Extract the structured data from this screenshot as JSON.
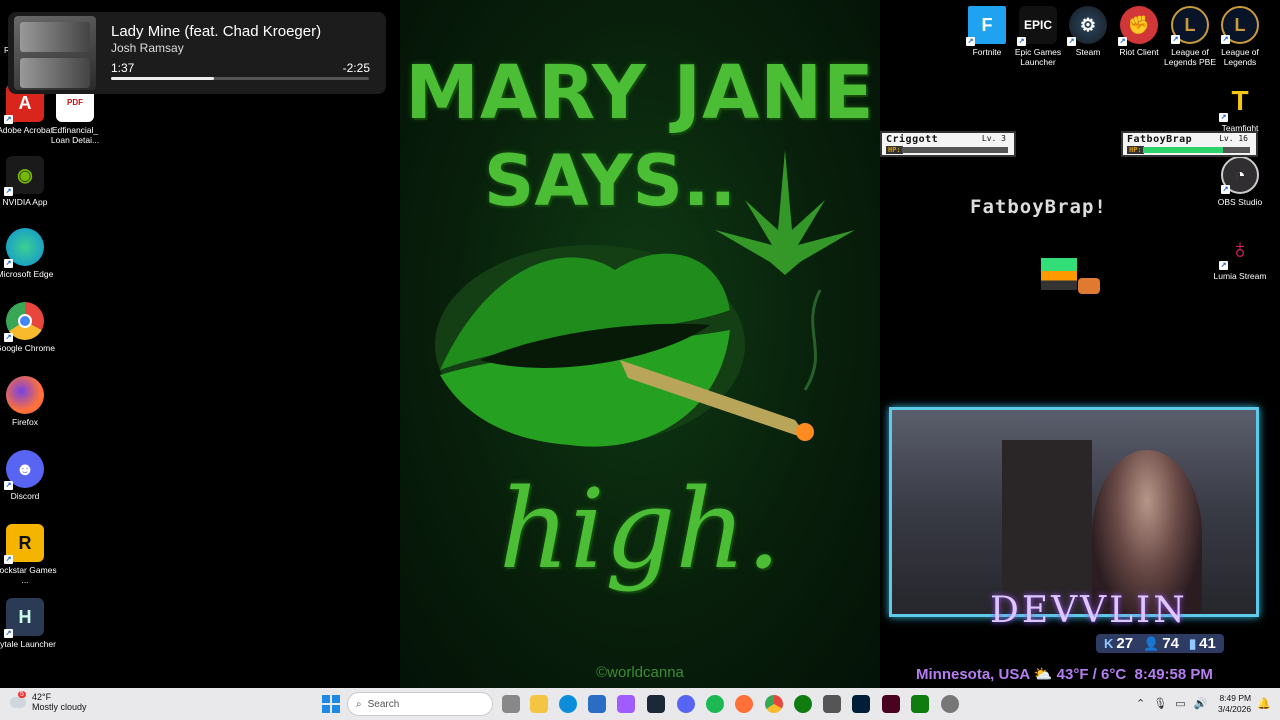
{
  "media": {
    "title": "Lady Mine (feat. Chad Kroeger)",
    "artist": "Josh Ramsay",
    "elapsed": "1:37",
    "remaining": "-2:25",
    "progress": 0.4
  },
  "desktop_icons_left": [
    {
      "label": "Adobe Acrobat",
      "icon": "acrobat-icon",
      "color": "#d9261c"
    },
    {
      "label": "Edfinancial_ Loan Detai...",
      "icon": "pdf-file-icon",
      "color": "#ffffff"
    },
    {
      "label": "NVIDIA App",
      "icon": "nvidia-icon",
      "color": "#76b900"
    },
    {
      "label": "Microsoft Edge",
      "icon": "edge-icon",
      "color": "#0c8fd8"
    },
    {
      "label": "Google Chrome",
      "icon": "chrome-icon",
      "color": "#e8453c"
    },
    {
      "label": "Firefox",
      "icon": "firefox-icon",
      "color": "#ff7139"
    },
    {
      "label": "Discord",
      "icon": "discord-icon",
      "color": "#5865f2"
    },
    {
      "label": "Rockstar Games ...",
      "icon": "rockstar-icon",
      "color": "#f4b400"
    },
    {
      "label": "Hytale Launcher",
      "icon": "hytale-icon",
      "color": "#2b3a55"
    }
  ],
  "desktop_icons_right": [
    {
      "label": "Fortnite",
      "icon": "fortnite-icon",
      "color": "#1fa3f0"
    },
    {
      "label": "Epic Games Launcher",
      "icon": "epic-games-icon",
      "color": "#111111"
    },
    {
      "label": "Steam",
      "icon": "steam-icon",
      "color": "#1b2838"
    },
    {
      "label": "Riot Client",
      "icon": "riot-icon",
      "color": "#d13639"
    },
    {
      "label": "League of Legends PBE",
      "icon": "league-pbe-icon",
      "color": "#c89b3c"
    },
    {
      "label": "League of Legends",
      "icon": "league-icon",
      "color": "#c89b3c"
    },
    {
      "label": "Teamfight",
      "icon": "teamfight-icon",
      "color": "#f5c518"
    },
    {
      "label": "OBS Studio",
      "icon": "obs-icon",
      "color": "#302e31"
    },
    {
      "label": "Lumia Stream",
      "icon": "lumia-icon",
      "color": "#e0245e"
    }
  ],
  "cut_label": "Re",
  "wallpaper": {
    "line1": "MARY JANE",
    "line2": "SAYS..",
    "line3": "high.",
    "credit": "©worldcanna"
  },
  "game": {
    "player1": {
      "name": "Criggott",
      "level": "Lv. 3",
      "hp_label": "HP:",
      "hp": 0.0
    },
    "player2": {
      "name": "FatboyBrap",
      "level": "Lv. 16",
      "hp_label": "HP:",
      "hp": 0.75
    },
    "message": "FatboyBrap!"
  },
  "stream": {
    "name": "DEVVLIN",
    "stat1": "27",
    "stat2": "74",
    "stat3": "41",
    "location": "Minnesota, USA",
    "temp": "43°F / 6°C",
    "time": "8:49:58 PM"
  },
  "taskbar": {
    "weather_temp": "42°F",
    "weather_desc": "Mostly cloudy",
    "search_placeholder": "Search",
    "clock_time": "8:49 PM",
    "clock_date": "3/4/2026",
    "weather_badge": "5"
  }
}
